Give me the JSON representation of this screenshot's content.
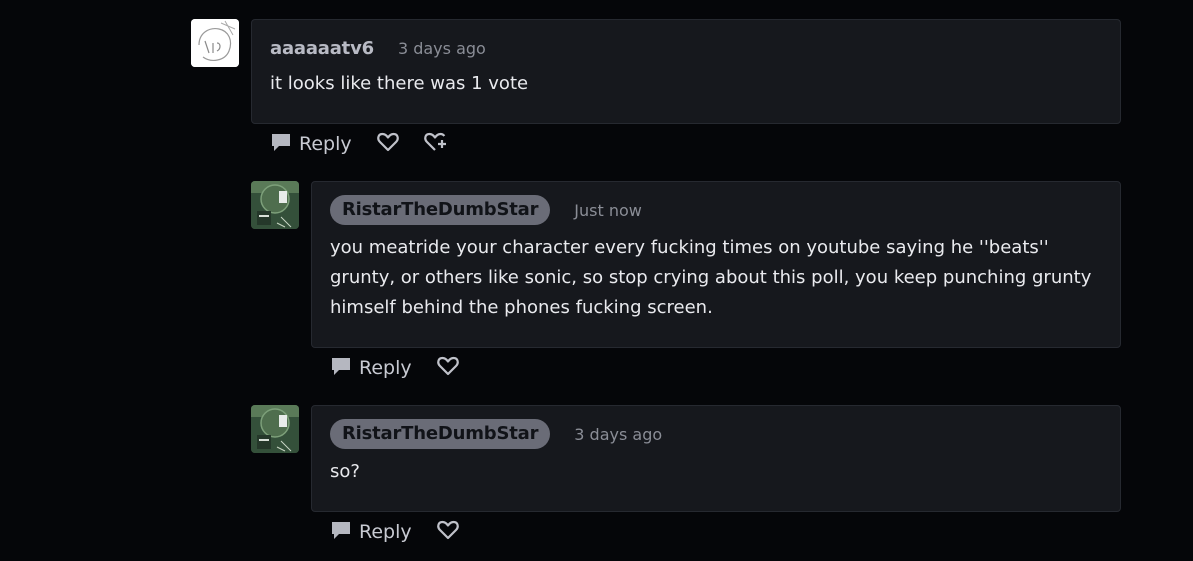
{
  "comments": [
    {
      "author": "aaaaaatv6",
      "time": "3 days ago",
      "text": "it looks like there was 1 vote",
      "reply_label": "Reply"
    },
    {
      "author": "RistarTheDumbStar",
      "time": "Just now",
      "text": "you meatride your character every fucking times on youtube saying he ''beats'' grunty, or others like sonic, so stop crying about this poll, you keep punching grunty himself behind the phones fucking screen.",
      "reply_label": "Reply"
    },
    {
      "author": "RistarTheDumbStar",
      "time": "3 days ago",
      "text": "so?",
      "reply_label": "Reply"
    }
  ],
  "icons": {
    "reply": "speech-bubble-icon",
    "like": "heart-icon",
    "add_like": "heart-plus-icon"
  },
  "colors": {
    "background": "#050609",
    "card": "#16181d",
    "pill": "#6a6c77"
  }
}
